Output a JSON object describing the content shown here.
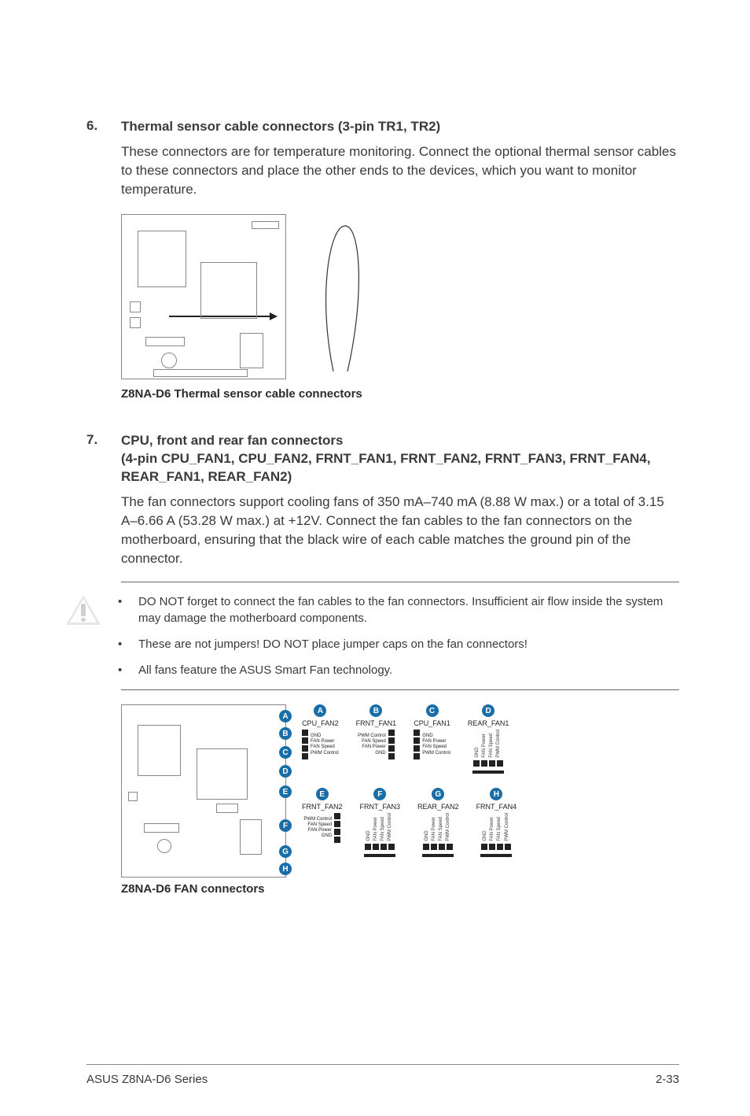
{
  "section6": {
    "num": "6.",
    "title": "Thermal sensor cable connectors (3-pin TR1, TR2)",
    "body": "These connectors are for temperature monitoring. Connect the optional thermal sensor cables to these connectors and place the other ends to the devices, which you want to monitor temperature.",
    "caption": "Z8NA-D6 Thermal sensor cable connectors"
  },
  "section7": {
    "num": "7.",
    "title_line1": "CPU, front and rear fan connectors",
    "title_line2": "(4-pin CPU_FAN1, CPU_FAN2, FRNT_FAN1, FRNT_FAN2, FRNT_FAN3, FRNT_FAN4, REAR_FAN1, REAR_FAN2)",
    "body": "The fan connectors support cooling fans of 350 mA–740 mA (8.88 W max.) or a total of 3.15 A–6.66 A (53.28 W max.) at +12V. Connect the fan cables to the fan connectors on the motherboard, ensuring that the black wire of each cable matches the ground pin of the connector.",
    "notes": [
      "DO NOT forget to connect the fan cables to the fan connectors. Insufficient air flow inside the system may damage the motherboard components.",
      "These are not jumpers! DO NOT place jumper caps on the fan connectors!",
      "All fans feature the ASUS Smart Fan technology."
    ],
    "caption": "Z8NA-D6 FAN connectors"
  },
  "fan_markers": [
    "A",
    "B",
    "C",
    "D",
    "E",
    "F",
    "G",
    "H"
  ],
  "fan_top": [
    {
      "badge": "A",
      "label": "CPU_FAN2",
      "pins": [
        "GND",
        "FAN Power",
        "FAN Speed",
        "PWM Control"
      ],
      "side": "right"
    },
    {
      "badge": "B",
      "label": "FRNT_FAN1",
      "pins": [
        "PWM Control",
        "FAN Speed",
        "FAN Power",
        "GND"
      ],
      "side": "left"
    },
    {
      "badge": "C",
      "label": "CPU_FAN1",
      "pins": [
        "GND",
        "FAN Power",
        "FAN Speed",
        "PWM Control"
      ],
      "side": "right"
    },
    {
      "badge": "D",
      "label": "REAR_FAN1",
      "pins": [
        "GND",
        "FAN Power",
        "FAN Speed",
        "PWM Control"
      ],
      "orient": "h"
    }
  ],
  "fan_bottom": [
    {
      "badge": "E",
      "label": "FRNT_FAN2",
      "pins": [
        "PWM Control",
        "FAN Speed",
        "FAN Power",
        "GND"
      ],
      "side": "left"
    },
    {
      "badge": "F",
      "label": "FRNT_FAN3",
      "pins": [
        "GND",
        "FAN Power",
        "FAN Speed",
        "PWM Control"
      ],
      "orient": "h"
    },
    {
      "badge": "G",
      "label": "REAR_FAN2",
      "pins": [
        "GND",
        "FAN Power",
        "FAN Speed",
        "PWM Control"
      ],
      "orient": "h"
    },
    {
      "badge": "H",
      "label": "FRNT_FAN4",
      "pins": [
        "GND",
        "FAN Power",
        "FAN Speed",
        "PWM Control"
      ],
      "orient": "h"
    }
  ],
  "footer": {
    "left": "ASUS Z8NA-D6 Series",
    "right": "2-33"
  }
}
